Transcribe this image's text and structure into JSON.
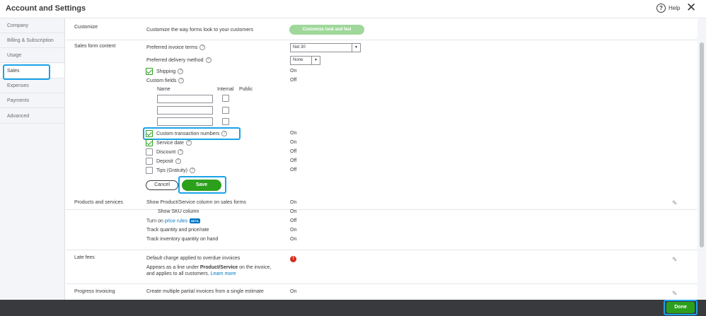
{
  "header": {
    "title": "Account and Settings",
    "help_label": "Help",
    "help_glyph": "?",
    "close_glyph": "✕"
  },
  "sidebar": {
    "items": [
      {
        "label": "Company"
      },
      {
        "label": "Billing & Subscription"
      },
      {
        "label": "Usage"
      },
      {
        "label": "Sales",
        "active": true
      },
      {
        "label": "Expenses"
      },
      {
        "label": "Payments"
      },
      {
        "label": "Advanced"
      }
    ]
  },
  "customize": {
    "label": "Customize",
    "desc": "Customize the way forms look to your customers",
    "button": "Customize look and feel"
  },
  "sales_form": {
    "label": "Sales form content",
    "invoice_terms_label": "Preferred invoice terms",
    "invoice_terms_value": "Net 30",
    "delivery_label": "Preferred delivery method",
    "delivery_value": "None",
    "shipping_label": "Shipping",
    "shipping_value": "On",
    "custom_fields_label": "Custom fields",
    "custom_fields_value": "Off",
    "col_name": "Name",
    "col_internal": "Internal",
    "col_public": "Public",
    "custom_txn_label": "Custom transaction numbers",
    "custom_txn_value": "On",
    "service_date_label": "Service date",
    "service_date_value": "On",
    "discount_label": "Discount",
    "discount_value": "Off",
    "deposit_label": "Deposit",
    "deposit_value": "Off",
    "tips_label": "Tips (Gratuity)",
    "tips_value": "Off",
    "cancel_label": "Cancel",
    "save_label": "Save"
  },
  "products": {
    "label": "Products and services",
    "rows": [
      {
        "label": "Show Product/Service column on sales forms",
        "value": "On"
      },
      {
        "label": "Show SKU column",
        "value": "On"
      },
      {
        "label_prefix": "Turn on",
        "link": "price rules",
        "badge": "BETA",
        "value": "Off"
      },
      {
        "label": "Track quantity and price/rate",
        "value": "On"
      },
      {
        "label": "Track inventory quantity on hand",
        "value": "On"
      }
    ]
  },
  "late_fees": {
    "label": "Late fees",
    "desc": "Default charge applied to overdue invoices",
    "note_1": "Appears as a line under",
    "note_bold": "Product/Service",
    "note_2": "on the invoice,",
    "note_3": "and applies to all customers.",
    "learn_more": "Learn more",
    "alert_glyph": "!"
  },
  "progress": {
    "label": "Progress Invoicing",
    "desc": "Create multiple partial invoices from a single estimate",
    "value": "On"
  },
  "footer": {
    "done_label": "Done"
  },
  "icons": {
    "pencil": "✎",
    "question": "?",
    "caret": "▼"
  }
}
